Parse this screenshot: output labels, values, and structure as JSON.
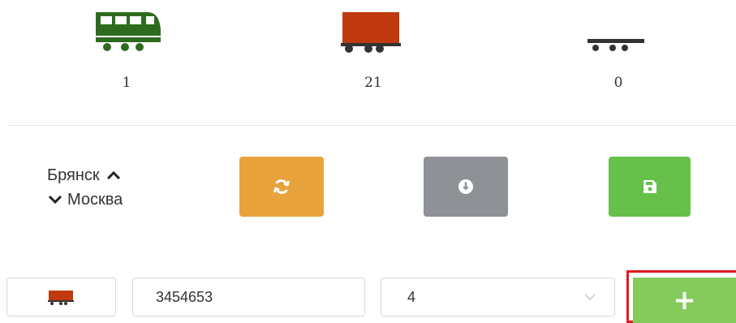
{
  "counters": [
    {
      "icon": "locomotive-icon",
      "value": "1"
    },
    {
      "icon": "freight-wagon-icon",
      "value": "21"
    },
    {
      "icon": "flatcar-icon",
      "value": "0"
    }
  ],
  "route": {
    "from": "Брянск",
    "to": "Москва"
  },
  "actions": {
    "refresh": {
      "icon": "refresh-icon",
      "color": "#e8a33d"
    },
    "download": {
      "icon": "download-icon",
      "color": "#8e9196"
    },
    "save": {
      "icon": "save-icon",
      "color": "#66c04a"
    }
  },
  "form": {
    "type_icon": "freight-wagon-icon",
    "number_value": "3454653",
    "count_value": "4",
    "add_label": "+"
  },
  "colors": {
    "locomotive": "#2f6b1f",
    "wagon": "#c0390f",
    "add_button": "#84ca5c",
    "highlight_border": "#e01b22"
  }
}
